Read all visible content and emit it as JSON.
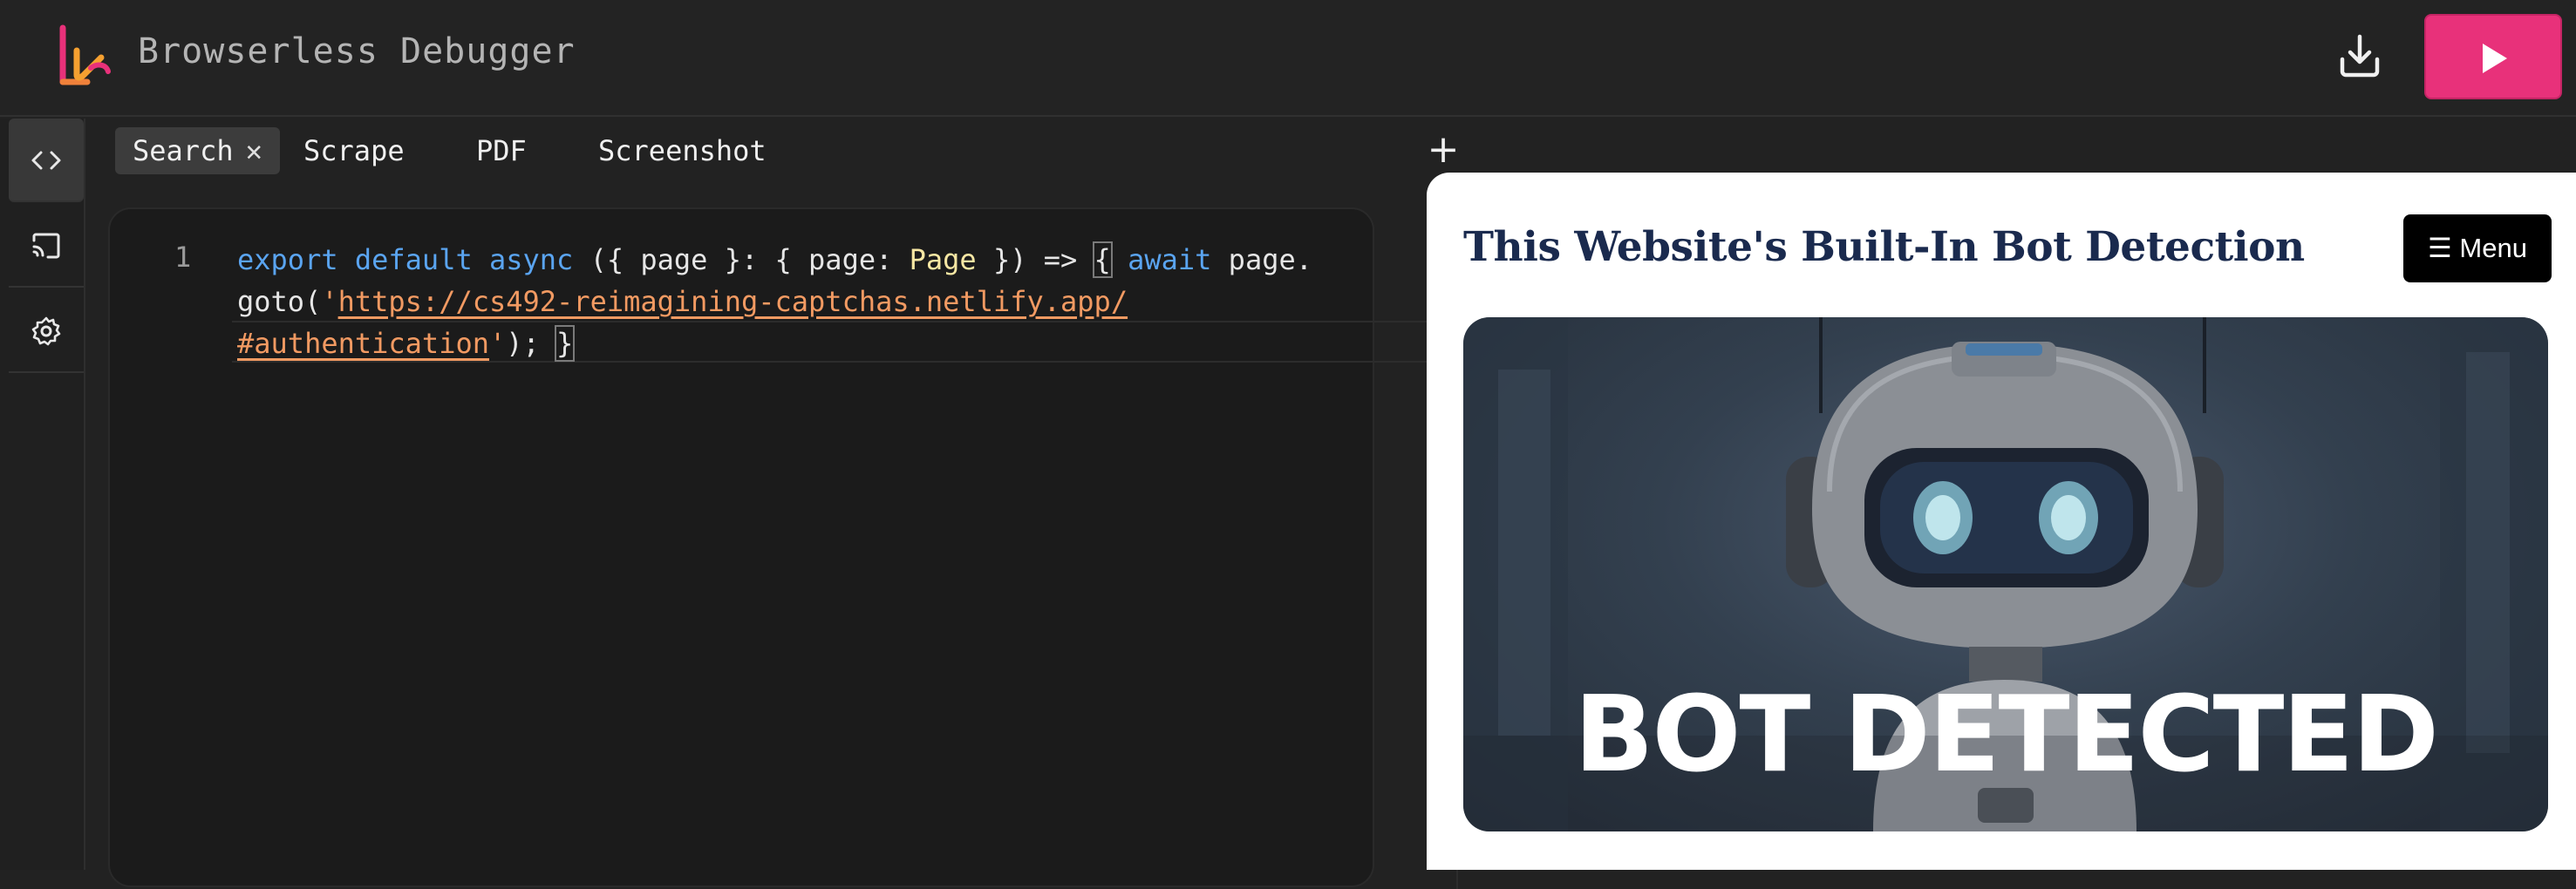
{
  "header": {
    "title": "Browserless Debugger",
    "logo_icon": "browserless-logo-icon",
    "download_icon": "download-icon",
    "run_icon": "play-icon",
    "accent_color": "#e8317a"
  },
  "rail": {
    "items": [
      {
        "icon": "code-icon",
        "active": true
      },
      {
        "icon": "cast-icon",
        "active": false
      },
      {
        "icon": "gear-icon",
        "active": false
      }
    ]
  },
  "tabs": {
    "items": [
      {
        "label": "Search",
        "active": true,
        "close": "✕"
      },
      {
        "label": "Scrape",
        "active": false
      },
      {
        "label": "PDF",
        "active": false
      },
      {
        "label": "Screenshot",
        "active": false
      }
    ],
    "add_label": "+"
  },
  "editor": {
    "line_number": "1",
    "code": {
      "t1": "export",
      "t2": " ",
      "t3": "default",
      "t4": " ",
      "t5": "async",
      "t6": " ({ page }: { page: ",
      "t7": "Page",
      "t8": " }) => ",
      "t9": "{",
      "t10": " ",
      "t11": "await",
      "t12": " page.",
      "t13": "goto(",
      "t14": "'",
      "t15": "https://cs492-reimagining-captchas.netlify.app/",
      "t16": "#authentication",
      "t17": "'",
      "t18": "); ",
      "t19": "}"
    }
  },
  "preview": {
    "heading": "This Website's Built-In Bot Detection",
    "menu_label": "☰ Menu",
    "hero_text": "BOT DETECTED"
  }
}
